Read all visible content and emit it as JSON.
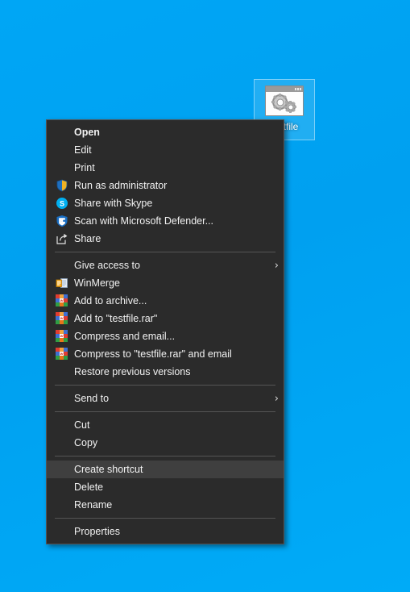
{
  "desktop": {
    "background_color": "#00a0f0",
    "icon": {
      "name": "testfile",
      "visible_label": "file",
      "icon_type": "application-exe-icon",
      "selected": true
    }
  },
  "context_menu": {
    "target_file": "testfile",
    "background_color": "#2b2b2b",
    "highlight_color": "#3f3f3f",
    "text_color": "#f2f2f2",
    "highlighted_item": "Create shortcut",
    "groups": [
      {
        "items": [
          {
            "label": "Open",
            "icon": null,
            "bold": true,
            "submenu": false
          },
          {
            "label": "Edit",
            "icon": null,
            "bold": false,
            "submenu": false
          },
          {
            "label": "Print",
            "icon": null,
            "bold": false,
            "submenu": false
          },
          {
            "label": "Run as administrator",
            "icon": "uac-shield-icon",
            "bold": false,
            "submenu": false
          },
          {
            "label": "Share with Skype",
            "icon": "skype-icon",
            "bold": false,
            "submenu": false
          },
          {
            "label": "Scan with Microsoft Defender...",
            "icon": "defender-shield-icon",
            "bold": false,
            "submenu": false
          },
          {
            "label": "Share",
            "icon": "share-icon",
            "bold": false,
            "submenu": false
          }
        ]
      },
      {
        "items": [
          {
            "label": "Give access to",
            "icon": null,
            "bold": false,
            "submenu": true
          },
          {
            "label": "WinMerge",
            "icon": "winmerge-icon",
            "bold": false,
            "submenu": false
          },
          {
            "label": "Add to archive...",
            "icon": "winrar-icon",
            "bold": false,
            "submenu": false
          },
          {
            "label": "Add to \"testfile.rar\"",
            "icon": "winrar-icon",
            "bold": false,
            "submenu": false
          },
          {
            "label": "Compress and email...",
            "icon": "winrar-icon",
            "bold": false,
            "submenu": false
          },
          {
            "label": "Compress to \"testfile.rar\" and email",
            "icon": "winrar-icon",
            "bold": false,
            "submenu": false
          },
          {
            "label": "Restore previous versions",
            "icon": null,
            "bold": false,
            "submenu": false
          }
        ]
      },
      {
        "items": [
          {
            "label": "Send to",
            "icon": null,
            "bold": false,
            "submenu": true
          }
        ]
      },
      {
        "items": [
          {
            "label": "Cut",
            "icon": null,
            "bold": false,
            "submenu": false
          },
          {
            "label": "Copy",
            "icon": null,
            "bold": false,
            "submenu": false
          }
        ]
      },
      {
        "items": [
          {
            "label": "Create shortcut",
            "icon": null,
            "bold": false,
            "submenu": false,
            "highlighted": true
          },
          {
            "label": "Delete",
            "icon": null,
            "bold": false,
            "submenu": false
          },
          {
            "label": "Rename",
            "icon": null,
            "bold": false,
            "submenu": false
          }
        ]
      },
      {
        "items": [
          {
            "label": "Properties",
            "icon": null,
            "bold": false,
            "submenu": false
          }
        ]
      }
    ],
    "submenu_arrow_glyph": "›"
  }
}
